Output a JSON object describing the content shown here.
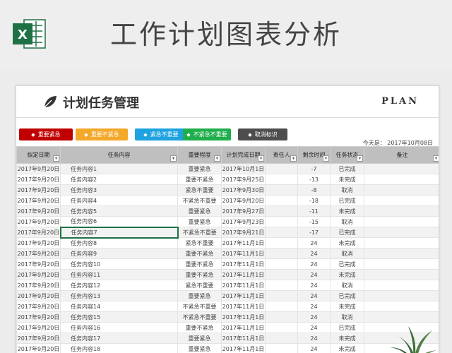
{
  "banner": {
    "title": "工作计划图表分析",
    "logo_letter": "X",
    "logo_color": "#1e7145"
  },
  "sheet": {
    "title": "计划任务管理",
    "plan_logo": "PLAN"
  },
  "legend": [
    {
      "label": "重要紧急",
      "color": "#c00000"
    },
    {
      "label": "重要不紧急",
      "color": "#f4a82b"
    },
    {
      "label": "紧急不重要",
      "color": "#1ea2e0"
    },
    {
      "label": "不紧急不重要",
      "color": "#1fae4b"
    },
    {
      "label": "取消标识",
      "color": "#4d4d4d"
    }
  ],
  "today": {
    "label": "今天是：",
    "value": "2017年10月08日"
  },
  "columns": [
    "拟定日期",
    "任务内容",
    "重要程度",
    "计划完成日期",
    "责任人",
    "剩余时间",
    "任务状态",
    "备注"
  ],
  "rows": [
    [
      "2017年9月20日",
      "任务内容1",
      "重要紧急",
      "2017年10月1日",
      "",
      "-7",
      "已完成",
      ""
    ],
    [
      "2017年9月20日",
      "任务内容2",
      "重要不紧急",
      "2017年9月25日",
      "",
      "-13",
      "未完成",
      ""
    ],
    [
      "2017年9月20日",
      "任务内容3",
      "紧急不重要",
      "2017年9月30日",
      "",
      "-8",
      "取消",
      ""
    ],
    [
      "2017年9月20日",
      "任务内容4",
      "不紧急不重要",
      "2017年9月20日",
      "",
      "-18",
      "已完成",
      ""
    ],
    [
      "2017年9月20日",
      "任务内容5",
      "重要紧急",
      "2017年9月27日",
      "",
      "-11",
      "未完成",
      ""
    ],
    [
      "2017年9月20日",
      "任务内容6",
      "重要紧急",
      "2017年9月23日",
      "",
      "-15",
      "取消",
      ""
    ],
    [
      "2017年9月20日",
      "任务内容7",
      "不紧急不重要",
      "2017年9月21日",
      "",
      "-17",
      "已完成",
      ""
    ],
    [
      "2017年9月20日",
      "任务内容8",
      "紧急不重要",
      "2017年11月1日",
      "",
      "24",
      "未完成",
      ""
    ],
    [
      "2017年9月20日",
      "任务内容9",
      "重要不紧急",
      "2017年11月1日",
      "",
      "24",
      "取消",
      ""
    ],
    [
      "2017年9月20日",
      "任务内容10",
      "重要不紧急",
      "2017年11月1日",
      "",
      "24",
      "已完成",
      ""
    ],
    [
      "2017年9月20日",
      "任务内容11",
      "重要不紧急",
      "2017年11月1日",
      "",
      "24",
      "未完成",
      ""
    ],
    [
      "2017年9月20日",
      "任务内容12",
      "紧急不重要",
      "2017年11月1日",
      "",
      "24",
      "取消",
      ""
    ],
    [
      "2017年9月20日",
      "任务内容13",
      "重要紧急",
      "2017年11月1日",
      "",
      "24",
      "已完成",
      ""
    ],
    [
      "2017年9月20日",
      "任务内容14",
      "不紧急不重要",
      "2017年11月1日",
      "",
      "24",
      "未完成",
      ""
    ],
    [
      "2017年9月20日",
      "任务内容15",
      "不紧急不重要",
      "2017年11月1日",
      "",
      "24",
      "取消",
      ""
    ],
    [
      "2017年9月20日",
      "任务内容16",
      "重要不紧急",
      "2017年11月1日",
      "",
      "24",
      "已完成",
      ""
    ],
    [
      "2017年9月20日",
      "任务内容17",
      "重要紧急",
      "2017年11月1日",
      "",
      "24",
      "未完成",
      ""
    ],
    [
      "2017年9月20日",
      "任务内容18",
      "重要紧急",
      "2017年11月1日",
      "",
      "24",
      "未完成",
      ""
    ]
  ],
  "selected_row": 6
}
